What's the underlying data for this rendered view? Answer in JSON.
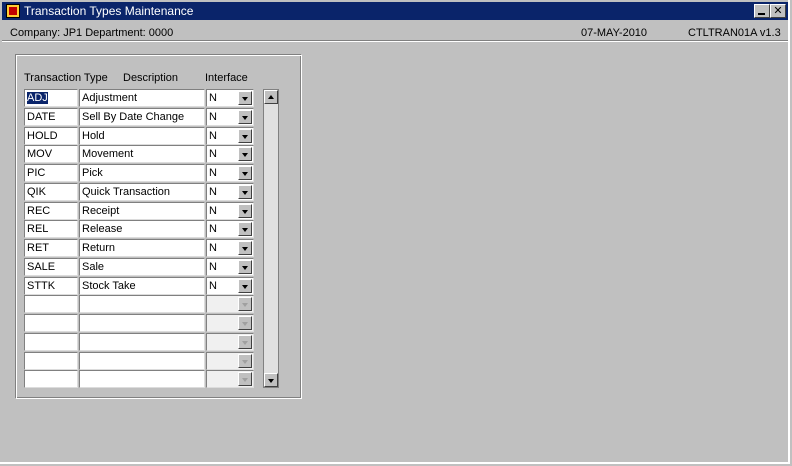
{
  "window": {
    "title": "Transaction Types Maintenance",
    "minimize_label": "_",
    "close_label": "✕"
  },
  "info": {
    "company_dept": "Company: JP1   Department: 0000",
    "date": "07-MAY-2010",
    "form": "CTLTRAN01A  v1.3"
  },
  "headers": {
    "type": "Transaction Type",
    "description": "Description",
    "interface": "Interface"
  },
  "rows": [
    {
      "type": "ADJ",
      "description": "Adjustment",
      "interface": "N"
    },
    {
      "type": "DATE",
      "description": "Sell By Date Change",
      "interface": "N"
    },
    {
      "type": "HOLD",
      "description": "Hold",
      "interface": "N"
    },
    {
      "type": "MOV",
      "description": "Movement",
      "interface": "N"
    },
    {
      "type": "PIC",
      "description": "Pick",
      "interface": "N"
    },
    {
      "type": "QIK",
      "description": "Quick Transaction",
      "interface": "N"
    },
    {
      "type": "REC",
      "description": "Receipt",
      "interface": "N"
    },
    {
      "type": "REL",
      "description": "Release",
      "interface": "N"
    },
    {
      "type": "RET",
      "description": "Return",
      "interface": "N"
    },
    {
      "type": "SALE",
      "description": "Sale",
      "interface": "N"
    },
    {
      "type": "STTK",
      "description": "Stock Take",
      "interface": "N"
    },
    {
      "type": "",
      "description": "",
      "interface": ""
    },
    {
      "type": "",
      "description": "",
      "interface": ""
    },
    {
      "type": "",
      "description": "",
      "interface": ""
    },
    {
      "type": "",
      "description": "",
      "interface": ""
    },
    {
      "type": "",
      "description": "",
      "interface": ""
    }
  ],
  "colors": {
    "titlebar": "#0a246a",
    "window_bg": "#c0c0c0",
    "selection": "#0a246a"
  },
  "icons": {
    "app": "oracle-forms-app-icon",
    "minimize": "minimize-icon",
    "close": "close-icon",
    "dropdown": "chevron-down-icon",
    "scroll_up": "scroll-up-arrow-icon",
    "scroll_down": "scroll-down-arrow-icon"
  }
}
